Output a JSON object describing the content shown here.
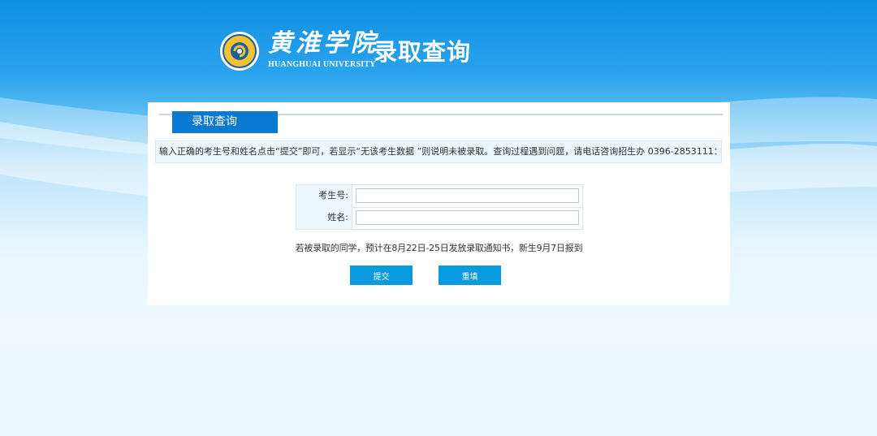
{
  "header": {
    "brand_cn": "黄淮学院",
    "brand_en": "HUANGHUAI UNIVERSITY",
    "title": "录取查询",
    "emblem_icon": "university-emblem-icon"
  },
  "panel": {
    "tab_label": "录取查询",
    "notice": "输入正确的考生号和姓名点击“提交”即可，若显示“无该考生数据 ”则说明未被录取。查询过程遇到问题，请电话咨询招生办 0396-2853111：",
    "form": {
      "exam_id_label": "考生号:",
      "exam_id_value": "",
      "name_label": "姓名:",
      "name_value": ""
    },
    "hint": "若被录取的同学，预计在8月22日-25日发放录取通知书，新生9月7日报到",
    "submit_label": "提交",
    "reset_label": "重填"
  },
  "colors": {
    "accent": "#0b78d1",
    "button": "#0a9ae0",
    "sky_top": "#0f8fe0",
    "sky_bottom": "#eaf6fd"
  }
}
